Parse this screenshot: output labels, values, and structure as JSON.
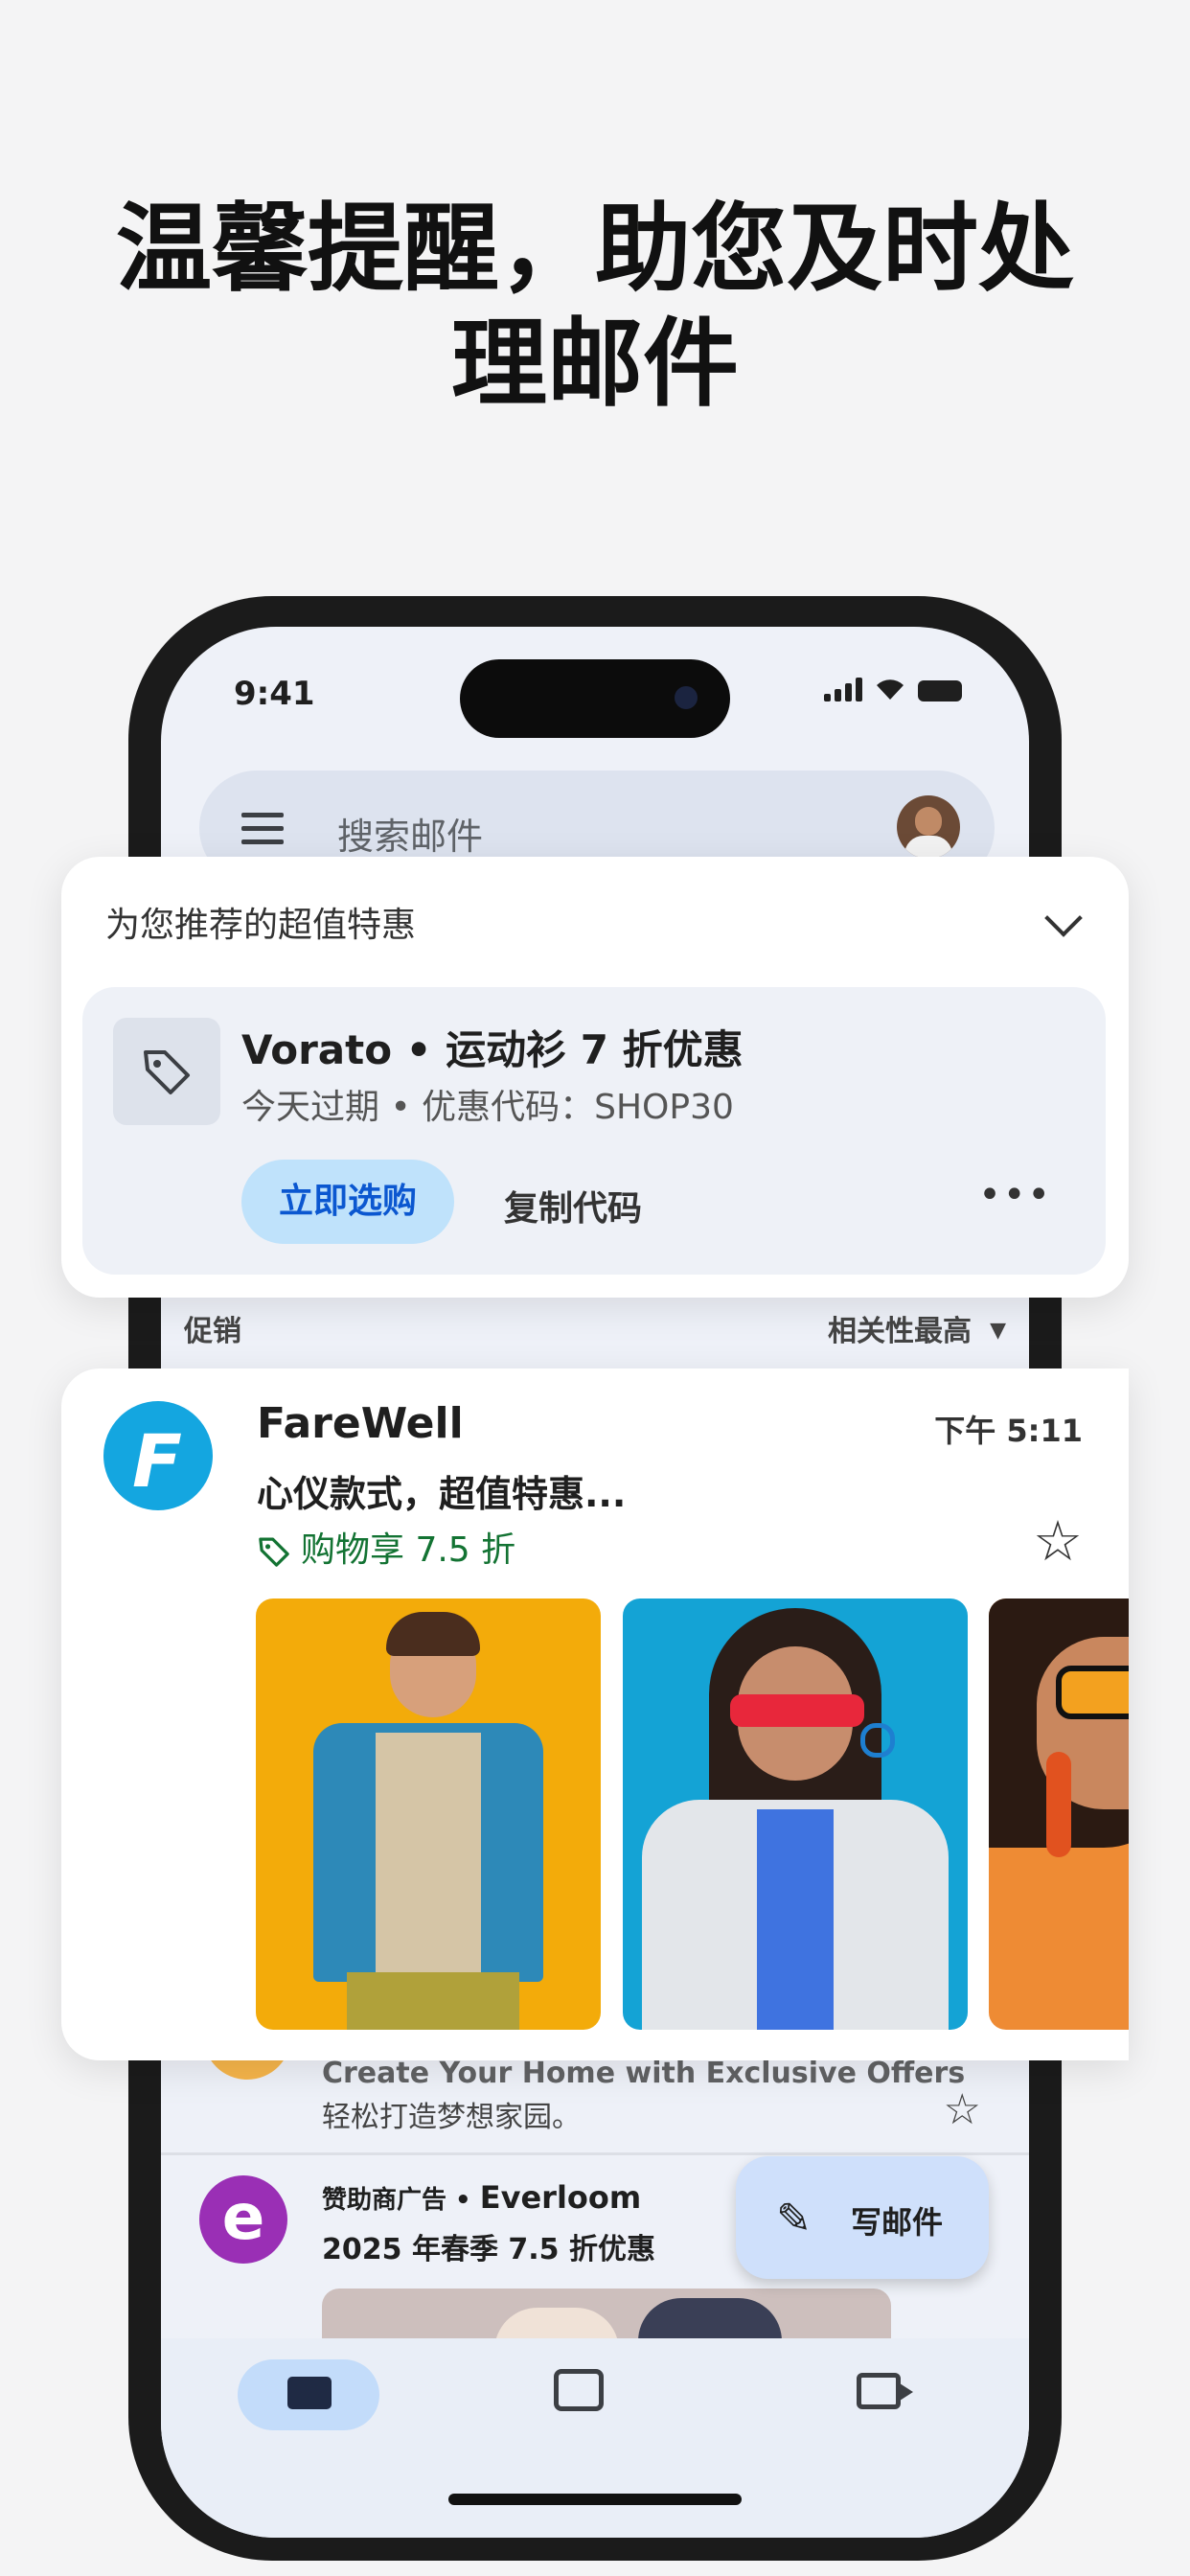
{
  "headline": {
    "line1": "温馨提醒，助您及时处",
    "line2": "理邮件"
  },
  "status_bar": {
    "time": "9:41"
  },
  "search": {
    "placeholder": "搜索邮件"
  },
  "promo_card": {
    "title": "为您推荐的超值特惠",
    "deal_name": "Vorato • 运动衫 7 折优惠",
    "deal_subtitle": "今天过期 • 优惠代码：SHOP30",
    "shop_button": "立即选购",
    "copy_button": "复制代码",
    "more_icon": "more-horizontal-icon"
  },
  "list_header": {
    "section": "促销",
    "sort": "相关性最高"
  },
  "email_card": {
    "sender": "FareWell",
    "time": "下午 5:11",
    "subject": "心仪款式，超值特惠...",
    "tag": "购物享 7.5 折",
    "tag_color": "#137333",
    "logo_letter": "F"
  },
  "background_email": {
    "partial_subject": "Create Your Home with Exclusive Offers",
    "snippet": "轻松打造梦想家园。"
  },
  "sponsored_email": {
    "ad_label": "赞助商广告 • ",
    "sender": "Everloom",
    "subject": "2025 年春季 7.5 折优惠",
    "logo_letter": "e"
  },
  "compose": {
    "label": "写邮件"
  },
  "nav": {
    "items": [
      "mail-icon",
      "chat-icon",
      "video-icon"
    ]
  }
}
